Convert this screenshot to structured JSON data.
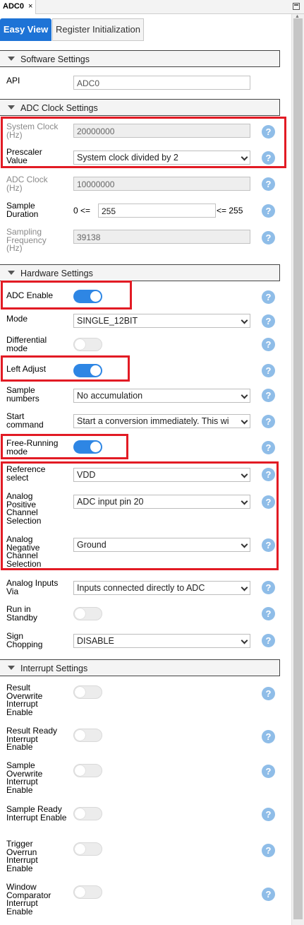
{
  "window": {
    "tab_title": "ADC0",
    "tab_close": "×"
  },
  "view_tabs": {
    "easy": "Easy View",
    "register": "Register Initialization"
  },
  "sections": {
    "software": "Software Settings",
    "clock": "ADC Clock Settings",
    "hardware": "Hardware Settings",
    "interrupt": "Interrupt Settings"
  },
  "software": {
    "api_label": "API",
    "api_value": "ADC0"
  },
  "clock": {
    "system_clock_label": "System Clock (Hz)",
    "system_clock_value": "20000000",
    "prescaler_label": "Prescaler Value",
    "prescaler_value": "System clock divided by 2",
    "adc_clock_label": "ADC Clock (Hz)",
    "adc_clock_value": "10000000",
    "sample_duration_label": "Sample Duration",
    "sample_duration_pre": "0 <=",
    "sample_duration_value": "255",
    "sample_duration_post": "<= 255",
    "sampling_freq_label": "Sampling Frequency (Hz)",
    "sampling_freq_value": "39138"
  },
  "hardware": {
    "adc_enable_label": "ADC Enable",
    "adc_enable": true,
    "mode_label": "Mode",
    "mode_value": "SINGLE_12BIT",
    "differential_label": "Differential mode",
    "differential": false,
    "left_adjust_label": "Left Adjust",
    "left_adjust": true,
    "sample_numbers_label": "Sample numbers",
    "sample_numbers_value": "No accumulation",
    "start_command_label": "Start command",
    "start_command_value": "Start a conversion immediately. This wi",
    "free_running_label": "Free-Running mode",
    "free_running": true,
    "reference_label": "Reference select",
    "reference_value": "VDD",
    "analog_pos_label": "Analog Positive Channel Selection",
    "analog_pos_value": "ADC input pin 20",
    "analog_neg_label": "Analog Negative Channel Selection",
    "analog_neg_value": "Ground",
    "analog_inputs_via_label": "Analog Inputs Via",
    "analog_inputs_via_value": "Inputs connected directly to ADC",
    "run_standby_label": "Run in Standby",
    "run_standby": false,
    "sign_chopping_label": "Sign Chopping",
    "sign_chopping_value": "DISABLE"
  },
  "interrupt": {
    "result_overwrite_label": "Result Overwrite Interrupt Enable",
    "result_ready_label": "Result Ready Interrupt Enable",
    "sample_overwrite_label": "Sample Overwrite Interrupt Enable",
    "sample_ready_label": "Sample Ready Interrupt Enable",
    "trigger_overrun_label": "Trigger Overrun Interrupt Enable",
    "window_comparator_label": "Window Comparator Interrupt Enable"
  },
  "help_glyph": "?",
  "colors": {
    "accent": "#1e73d6",
    "toggle_on": "#2e86e4",
    "help": "#8fbde8",
    "highlight": "#e21b24"
  }
}
